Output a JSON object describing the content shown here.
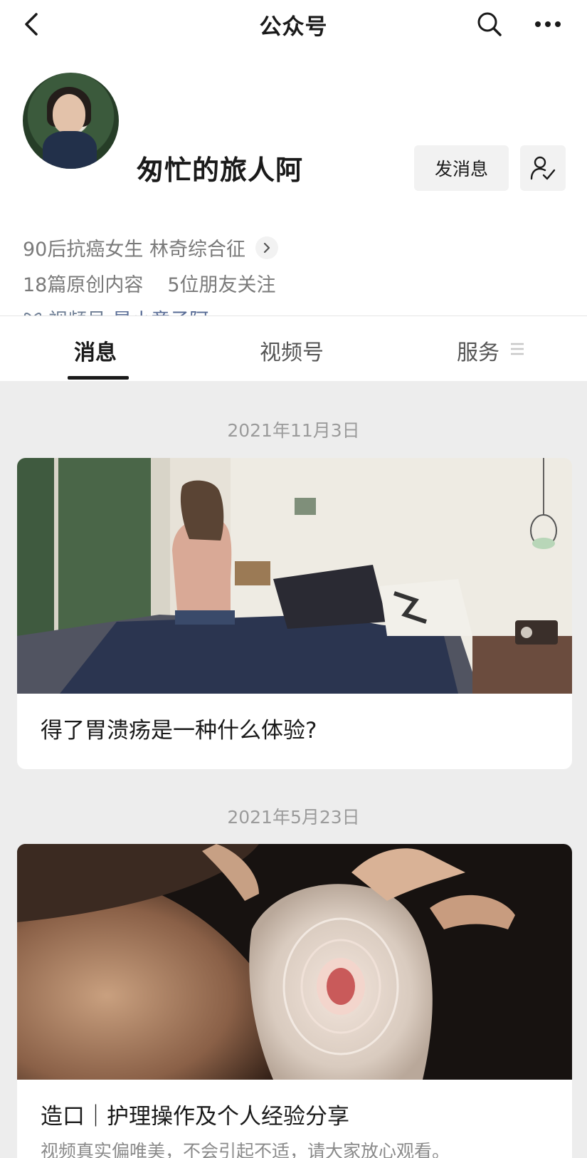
{
  "navbar": {
    "title": "公众号",
    "back_icon": "chevron-left-icon",
    "search_icon": "search-icon",
    "more_icon": "more-dots-icon"
  },
  "profile": {
    "name": "匆忙的旅人阿",
    "message_button": "发消息",
    "follow_icon": "user-check-icon",
    "bio": "90后抗癌女生 林奇综合征",
    "original_count": "18篇原创内容",
    "friends_following": "5位朋友关注",
    "channel_label": "视频号:",
    "channel_value": "是小意子阿"
  },
  "tabs": [
    {
      "label": "消息",
      "active": true
    },
    {
      "label": "视频号",
      "active": false
    },
    {
      "label": "服务",
      "active": false
    }
  ],
  "feed": [
    {
      "date": "2021年11月3日",
      "title": "得了胃溃疡是一种什么体验?",
      "image": "illustration-woman-sitting-on-bed"
    },
    {
      "date": "2021年5月23日",
      "title": "造口｜护理操作及个人经验分享",
      "subtitle": "视频真实偏唯美，不会引起不适，请大家放心观看。",
      "image": "photo-ostomy-bag"
    }
  ],
  "colors": {
    "background": "#ededed",
    "link": "#576b95",
    "secondary_text": "#7a7a7a"
  }
}
